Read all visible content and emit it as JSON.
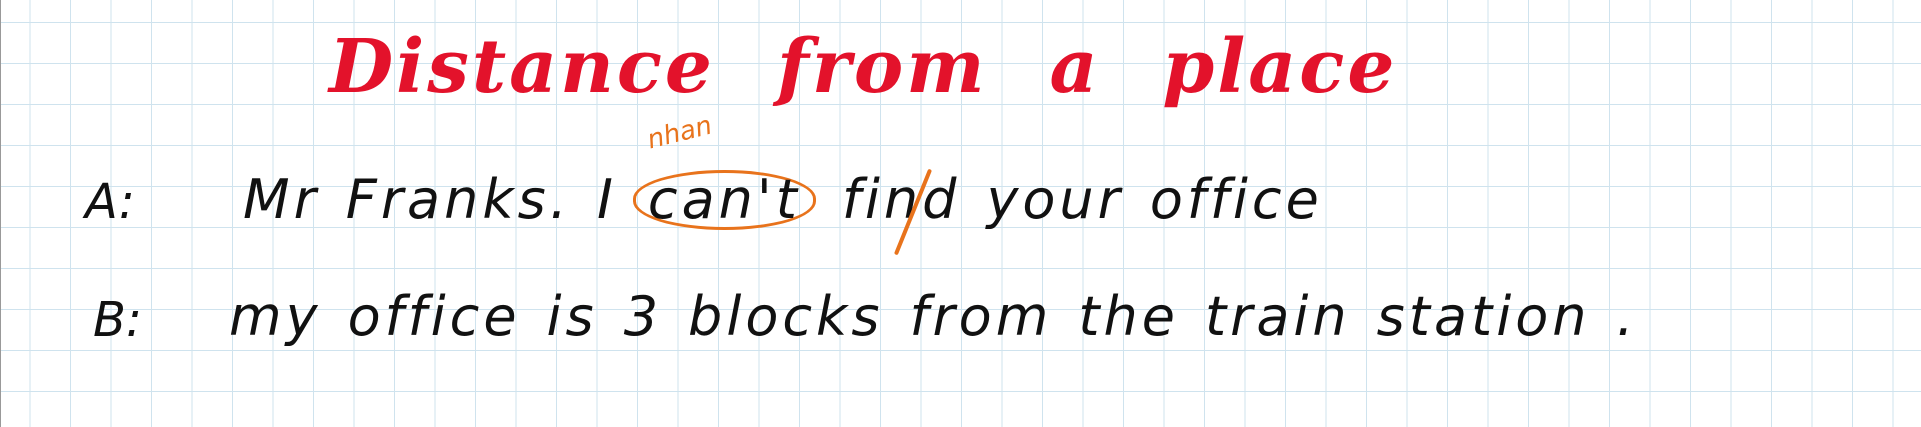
{
  "title": [
    "Distance",
    "from",
    "a",
    "place"
  ],
  "annotation": "nhan",
  "dialogue": [
    {
      "speaker": "A:",
      "words_before": [
        "Mr",
        "Franks.",
        "I"
      ],
      "circled_word": "can't",
      "words_after": [
        "find",
        "your",
        "office"
      ]
    },
    {
      "speaker": "B:",
      "words": [
        "my",
        "office",
        "is",
        "3",
        "blocks",
        "from",
        "the",
        "train",
        "station",
        "."
      ]
    }
  ],
  "colors": {
    "title": "#e3122b",
    "ink": "#111111",
    "highlight": "#e8731c",
    "grid": "#cfe3ee"
  }
}
